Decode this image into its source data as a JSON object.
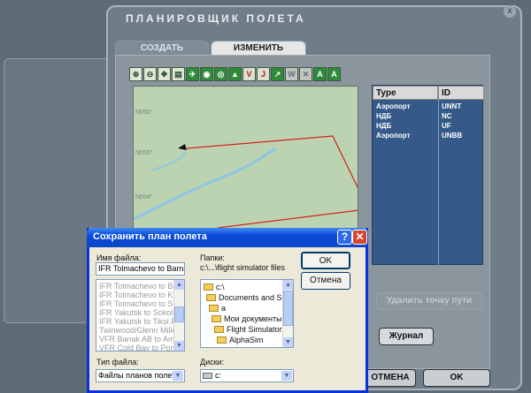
{
  "planner": {
    "title": "ПЛАНИРОВЩИК ПОЛЕТА",
    "close_glyph": "x",
    "tabs": [
      {
        "label": "СОЗДАТЬ"
      },
      {
        "label": "ИЗМЕНИТЬ"
      }
    ],
    "toolbar": {
      "buttons": [
        {
          "icon": "zoom-in-icon",
          "glyph": "⊕"
        },
        {
          "icon": "zoom-out-icon",
          "glyph": "⊖"
        },
        {
          "icon": "pan-icon",
          "glyph": "✥"
        },
        {
          "icon": "print-icon",
          "glyph": "▤"
        },
        {
          "icon": "airport-filter-icon",
          "glyph": "✈"
        },
        {
          "icon": "vor-filter-icon",
          "glyph": "◉"
        },
        {
          "icon": "ndb-filter-icon",
          "glyph": "◎"
        },
        {
          "icon": "intersection-filter-icon",
          "glyph": "▲"
        },
        {
          "icon": "victor-airways-icon",
          "glyph": "V"
        },
        {
          "icon": "jet-airways-icon",
          "glyph": "J"
        },
        {
          "icon": "route-icon",
          "glyph": "↗"
        },
        {
          "icon": "wind-icon",
          "glyph": "W"
        },
        {
          "icon": "cross-icon",
          "glyph": "✕"
        },
        {
          "icon": "text-label-icon",
          "glyph": "A"
        },
        {
          "icon": "text-size-icon",
          "glyph": "A"
        }
      ]
    },
    "map": {
      "grid_labels": [
        "N056°",
        "N055°",
        "N054°"
      ]
    },
    "waypoints": {
      "headers": {
        "type": "Type",
        "id": "ID"
      },
      "rows": [
        {
          "type": "Аэропорт",
          "id": "UNNT"
        },
        {
          "type": "НДБ",
          "id": "NC"
        },
        {
          "type": "НДБ",
          "id": "UF"
        },
        {
          "type": "Аэропорт",
          "id": "UNBB"
        }
      ]
    },
    "buttons": {
      "delete_waypoint": "Удалить точку пути",
      "journal": "Журнал",
      "cancel": "ОТМЕНА",
      "ok": "OK"
    }
  },
  "dialog": {
    "title": "Сохранить план полета",
    "help_glyph": "?",
    "close_glyph": "✕",
    "filename_label": "Имя файла:",
    "filename_value": "IFR Tolmachevo to Barnau",
    "file_list": [
      "IFR Tolmachevo to Barı",
      "IFR Tolmachevo to Krau",
      "IFR Tolmachevo to Sur",
      "IFR Yakutsk to Sokol.P",
      "IFR Yakutsk to Tiksi.Pl",
      "Twinwood/Glenn Miller",
      "VFR Banak AB to Amde",
      "VFR Cold Bay to Port H"
    ],
    "folders_label": "Папки:",
    "folder_path": "c:\\...\\flight simulator files",
    "folders": [
      "c:\\",
      "Documents and Set",
      "a",
      "Мои документы",
      "Flight Simulator Fi",
      "AlphaSim"
    ],
    "filetype_label": "Тип файла:",
    "filetype_value": "Файлы планов полета",
    "drives_label": "Диски:",
    "drive_value": "c:",
    "ok_button": "OK",
    "cancel_button": "Отмена"
  }
}
